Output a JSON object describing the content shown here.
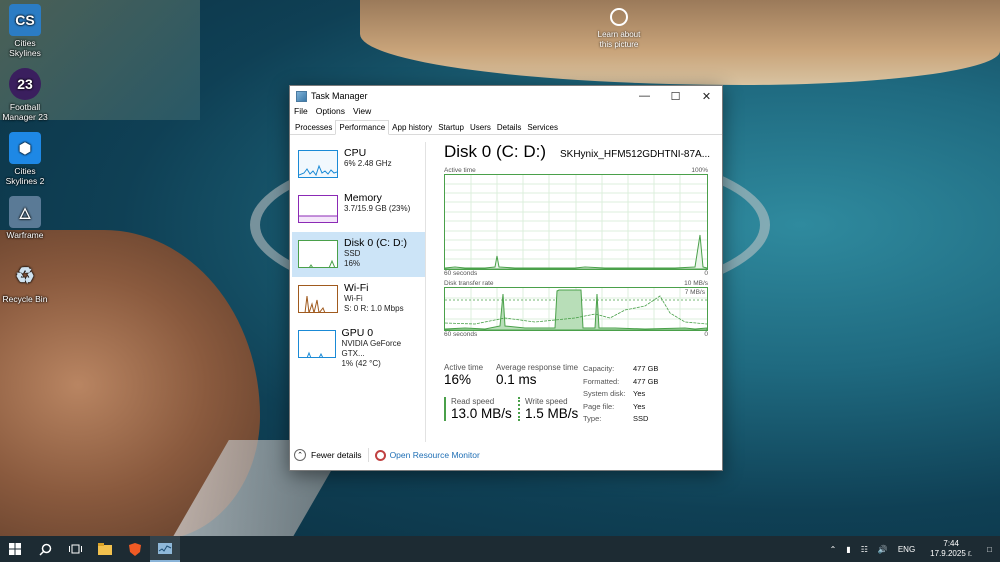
{
  "desktop": {
    "icons": [
      {
        "label": "Cities Skylines",
        "short": "CS",
        "color": "#2b7cc4"
      },
      {
        "label": "Football Manager 23",
        "short": "23",
        "color": "#3a1f5e"
      },
      {
        "label": "Cities Skylines 2",
        "short": "⬢",
        "color": "#1e88e5"
      },
      {
        "label": "Warframe",
        "short": "△",
        "color": "#5a7a96"
      },
      {
        "label": "Recycle Bin",
        "short": "♻",
        "color": "#9fb7c9"
      }
    ],
    "learn_about": "Learn about this picture"
  },
  "window": {
    "title": "Task Manager",
    "controls": {
      "minimize": "—",
      "maximize": "☐",
      "close": "✕"
    },
    "menu": [
      "File",
      "Options",
      "View"
    ],
    "tabs": [
      "Processes",
      "Performance",
      "App history",
      "Startup",
      "Users",
      "Details",
      "Services"
    ],
    "active_tab": "Performance"
  },
  "sidebar": {
    "items": [
      {
        "name": "CPU",
        "line1": "6% 2.48 GHz",
        "line2": "",
        "color": "#1a8ad6"
      },
      {
        "name": "Memory",
        "line1": "3.7/15.9 GB (23%)",
        "line2": "",
        "color": "#8b2ab5"
      },
      {
        "name": "Disk 0 (C: D:)",
        "line1": "SSD",
        "line2": "16%",
        "color": "#4aa04a"
      },
      {
        "name": "Wi-Fi",
        "line1": "Wi-Fi",
        "line2": "S: 0 R: 1.0 Mbps",
        "color": "#a05a1e"
      },
      {
        "name": "GPU 0",
        "line1": "NVIDIA GeForce GTX...",
        "line2": "1% (42 °C)",
        "color": "#1a8ad6"
      }
    ]
  },
  "detail": {
    "title": "Disk 0 (C: D:)",
    "model": "SKHynix_HFM512GDHTNI-87A...",
    "graph1": {
      "label": "Active time",
      "max": "100%",
      "time": "60 seconds",
      "min": "0"
    },
    "graph2": {
      "label": "Disk transfer rate",
      "max": "10 MB/s",
      "ref": "7 MB/s",
      "time": "60 seconds",
      "min": "0"
    },
    "stats": {
      "active_time_label": "Active time",
      "active_time": "16%",
      "response_label": "Average response time",
      "response": "0.1 ms",
      "read_label": "Read speed",
      "read": "13.0 MB/s",
      "write_label": "Write speed",
      "write": "1.5 MB/s"
    },
    "props": [
      {
        "k": "Capacity:",
        "v": "477 GB"
      },
      {
        "k": "Formatted:",
        "v": "477 GB"
      },
      {
        "k": "System disk:",
        "v": "Yes"
      },
      {
        "k": "Page file:",
        "v": "Yes"
      },
      {
        "k": "Type:",
        "v": "SSD"
      }
    ]
  },
  "footer": {
    "fewer": "Fewer details",
    "monitor": "Open Resource Monitor"
  },
  "taskbar": {
    "lang": "ENG",
    "time": "7:44",
    "date": "17.9.2025 г."
  }
}
